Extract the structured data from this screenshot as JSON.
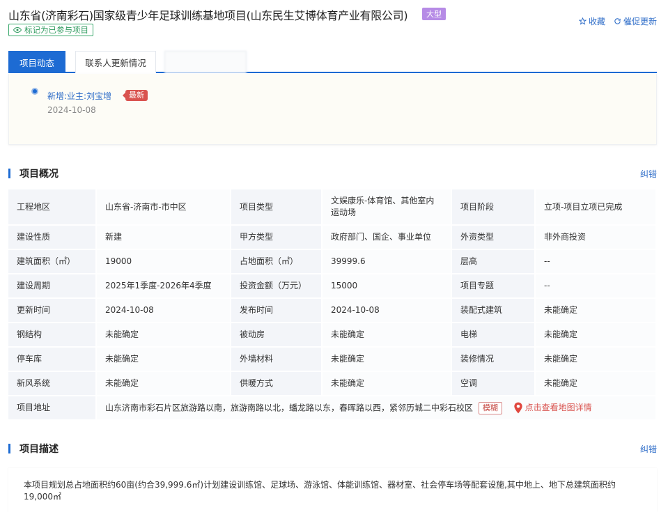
{
  "header": {
    "title": "山东省(济南彩石)国家级青少年足球训练基地项目(山东民生艾博体育产业有限公司)",
    "size_tag": "大型",
    "favorite_label": "收藏",
    "urge_update_label": "催促更新",
    "mark_participated_label": "标记为已参与项目"
  },
  "tabs": [
    {
      "label": "项目动态",
      "active": true
    },
    {
      "label": "联系人更新情况",
      "active": false
    },
    {
      "label": "",
      "active": false
    }
  ],
  "feed": {
    "item_text": "新增:业主:刘宝增",
    "badge": "最新",
    "date": "2024-10-08"
  },
  "overview": {
    "section_title": "项目概况",
    "fix_label": "纠错",
    "rows": [
      [
        [
          "工程地区",
          "山东省-济南市-市中区"
        ],
        [
          "项目类型",
          "文娱康乐-体育馆、其他室内运动场"
        ],
        [
          "项目阶段",
          "立项-项目立项已完成"
        ]
      ],
      [
        [
          "建设性质",
          "新建"
        ],
        [
          "甲方类型",
          "政府部门、国企、事业单位"
        ],
        [
          "外资类型",
          "非外商投资"
        ]
      ],
      [
        [
          "建筑面积（㎡）",
          "19000"
        ],
        [
          "占地面积（㎡）",
          "39999.6"
        ],
        [
          "层高",
          "--"
        ]
      ],
      [
        [
          "建设周期",
          "2025年1季度-2026年4季度"
        ],
        [
          "投资金额（万元）",
          "15000"
        ],
        [
          "项目专题",
          "--"
        ]
      ],
      [
        [
          "更新时间",
          "2024-10-08"
        ],
        [
          "发布时间",
          "2024-10-08"
        ],
        [
          "装配式建筑",
          "未能确定"
        ]
      ],
      [
        [
          "钢结构",
          "未能确定"
        ],
        [
          "被动房",
          "未能确定"
        ],
        [
          "电梯",
          "未能确定"
        ]
      ],
      [
        [
          "停车库",
          "未能确定"
        ],
        [
          "外墙材料",
          "未能确定"
        ],
        [
          "装修情况",
          "未能确定"
        ]
      ],
      [
        [
          "新风系统",
          "未能确定"
        ],
        [
          "供暖方式",
          "未能确定"
        ],
        [
          "空调",
          "未能确定"
        ]
      ]
    ],
    "address_label": "项目地址",
    "address_value": "山东济南市彩石片区旅游路以南，旅游南路以北，蟠龙路以东，春晖路以西，紧邻历城二中彩石校区",
    "fuzzy_label": "模糊",
    "map_link_label": "点击查看地图详情"
  },
  "description": {
    "section_title": "项目描述",
    "fix_label": "纠错",
    "text": "本项目规划总占地面积约60亩(约合39,999.6㎡)计划建设训练馆、足球场、游泳馆、体能训练馆、器材室、社会停车场等配套设施,其中地上、地下总建筑面积约19,000㎡"
  },
  "icons": {
    "favorite": "star-outline-icon",
    "urge": "refresh-icon",
    "mark": "eye-icon",
    "map": "map-pin-icon"
  },
  "colors": {
    "primary": "#1d6bd3",
    "size_tag": "#b68be6",
    "badge_new": "#d9534f",
    "mark_green": "#2e9b5e",
    "map_link": "#d9534f"
  }
}
